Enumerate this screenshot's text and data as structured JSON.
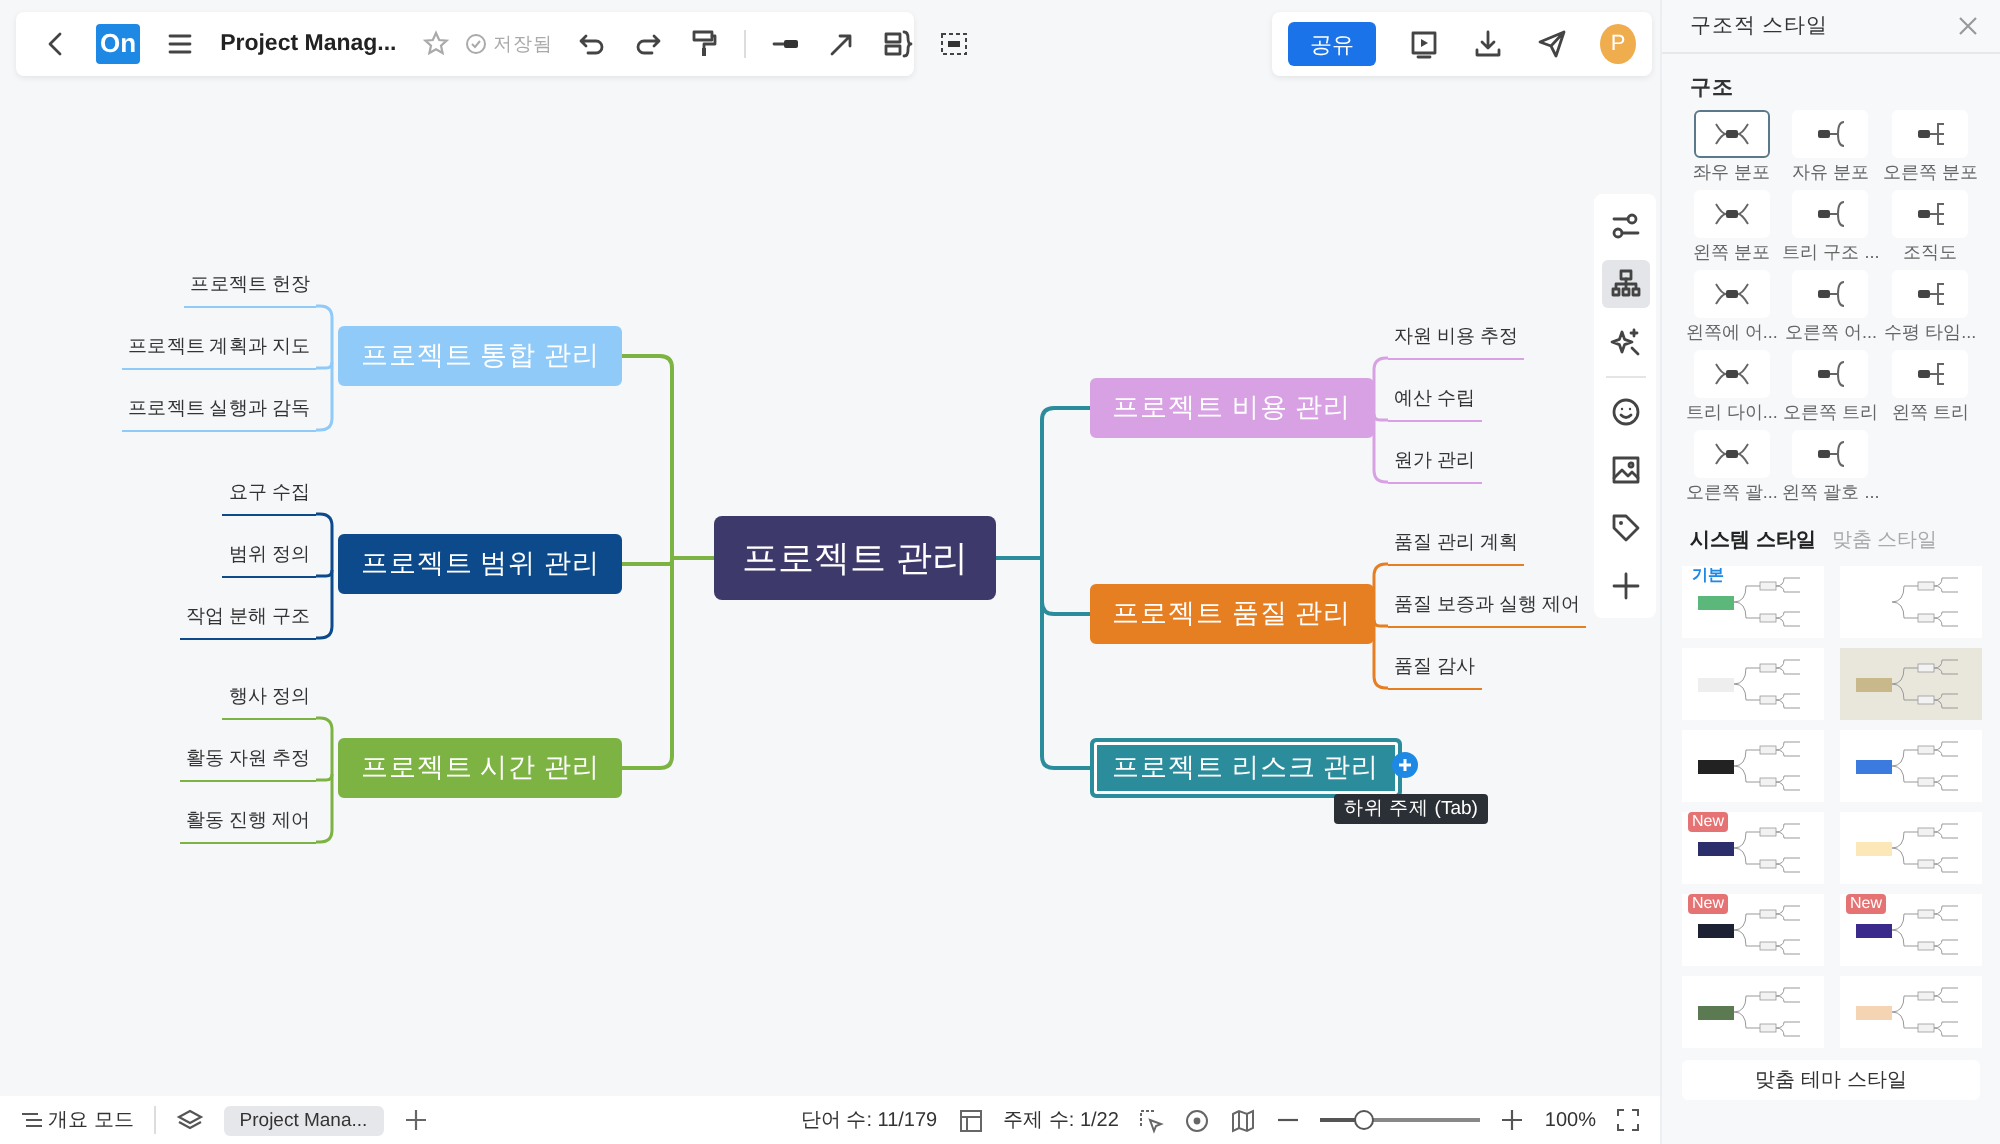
{
  "toolbar": {
    "logo": "On",
    "title": "Project Manag...",
    "save_status": "저장됨"
  },
  "share": {
    "button": "공유",
    "avatar": "P"
  },
  "mindmap": {
    "root": {
      "text": "프로젝트 관리",
      "color": "#3d3a6b"
    },
    "left_branches": [
      {
        "text": "프로젝트 통합 관리",
        "color": "#90caf9",
        "selected": false,
        "children": [
          {
            "text": "프로젝트 헌장"
          },
          {
            "text": "프로젝트 계획과 지도"
          },
          {
            "text": "프로젝트 실행과 감독"
          }
        ]
      },
      {
        "text": "프로젝트 범위 관리",
        "color": "#0d4a8c",
        "selected": false,
        "children": [
          {
            "text": "요구 수집"
          },
          {
            "text": "범위 정의"
          },
          {
            "text": "작업 분해 구조"
          }
        ]
      },
      {
        "text": "프로젝트 시간 관리",
        "color": "#7cb342",
        "selected": false,
        "children": [
          {
            "text": "행사 정의"
          },
          {
            "text": "활동 자원 추정"
          },
          {
            "text": "활동 진행 제어"
          }
        ]
      }
    ],
    "right_branches": [
      {
        "text": "프로젝트 비용 관리",
        "color": "#d7a1e3",
        "selected": false,
        "children": [
          {
            "text": "자원 비용 추정"
          },
          {
            "text": "예산 수립"
          },
          {
            "text": "원가 관리"
          }
        ]
      },
      {
        "text": "프로젝트 품질 관리",
        "color": "#e67e22",
        "selected": false,
        "children": [
          {
            "text": "품질 관리 계획"
          },
          {
            "text": "품질 보증과 실행 제어"
          },
          {
            "text": "품질 감사"
          }
        ]
      },
      {
        "text": "프로젝트 리스크 관리",
        "color": "#2b8c9c",
        "selected": true
      }
    ],
    "tooltip": "하위 주제 (Tab)"
  },
  "side_tools": [
    {
      "kind": "settings",
      "selected": false
    },
    {
      "kind": "structure",
      "selected": true
    },
    {
      "kind": "sparkle",
      "selected": false
    },
    {
      "kind": "emoji",
      "selected": false
    },
    {
      "kind": "image",
      "selected": false
    },
    {
      "kind": "tag",
      "selected": false
    },
    {
      "kind": "add",
      "selected": false
    }
  ],
  "panel": {
    "title": "구조적 스타일",
    "section": "구조",
    "structures": [
      {
        "label": "좌우 분포",
        "selected": true
      },
      {
        "label": "자유 분포",
        "selected": false
      },
      {
        "label": "오른쪽 분포",
        "selected": false
      },
      {
        "label": "왼쪽 분포",
        "selected": false
      },
      {
        "label": "트리 구조 ...",
        "selected": false
      },
      {
        "label": "조직도",
        "selected": false
      },
      {
        "label": "왼쪽에 어...",
        "selected": false
      },
      {
        "label": "오른쪽 어...",
        "selected": false
      },
      {
        "label": "수평 타임...",
        "selected": false
      },
      {
        "label": "트리 다이...",
        "selected": false
      },
      {
        "label": "오른쪽 트리",
        "selected": false
      },
      {
        "label": "왼쪽 트리",
        "selected": false
      },
      {
        "label": "오른쪽 괄...",
        "selected": false
      },
      {
        "label": "왼쪽 괄호 ...",
        "selected": false
      }
    ],
    "style_tabs": [
      {
        "label": "시스템 스타일",
        "selected": true
      },
      {
        "label": "맞춤 스타일",
        "selected": false
      }
    ],
    "themes": [
      {
        "badge": "기본",
        "color": "#5cb87a"
      },
      {
        "color": "#ffffff"
      },
      {
        "color": "#eeeeee"
      },
      {
        "color": "#c8b88a"
      },
      {
        "color": "#222222"
      },
      {
        "color": "#3b7be0"
      },
      {
        "badge": "New",
        "color": "#2a2f6b"
      },
      {
        "color": "#fbe7b8"
      },
      {
        "badge": "New",
        "color": "#1c2233"
      },
      {
        "badge": "New",
        "color": "#3a2a8c"
      },
      {
        "color": "#5c7a52"
      },
      {
        "color": "#f5d4b3"
      }
    ],
    "button": "맞춤 테마 스타일"
  },
  "status_bar": {
    "outline": "개요 모드",
    "page_tab": "Project Mana...",
    "word_count": "단어 수: 11/179",
    "topic_count": "주제 수: 1/22",
    "zoom": {
      "level": 0.27,
      "reading": "100%"
    }
  }
}
